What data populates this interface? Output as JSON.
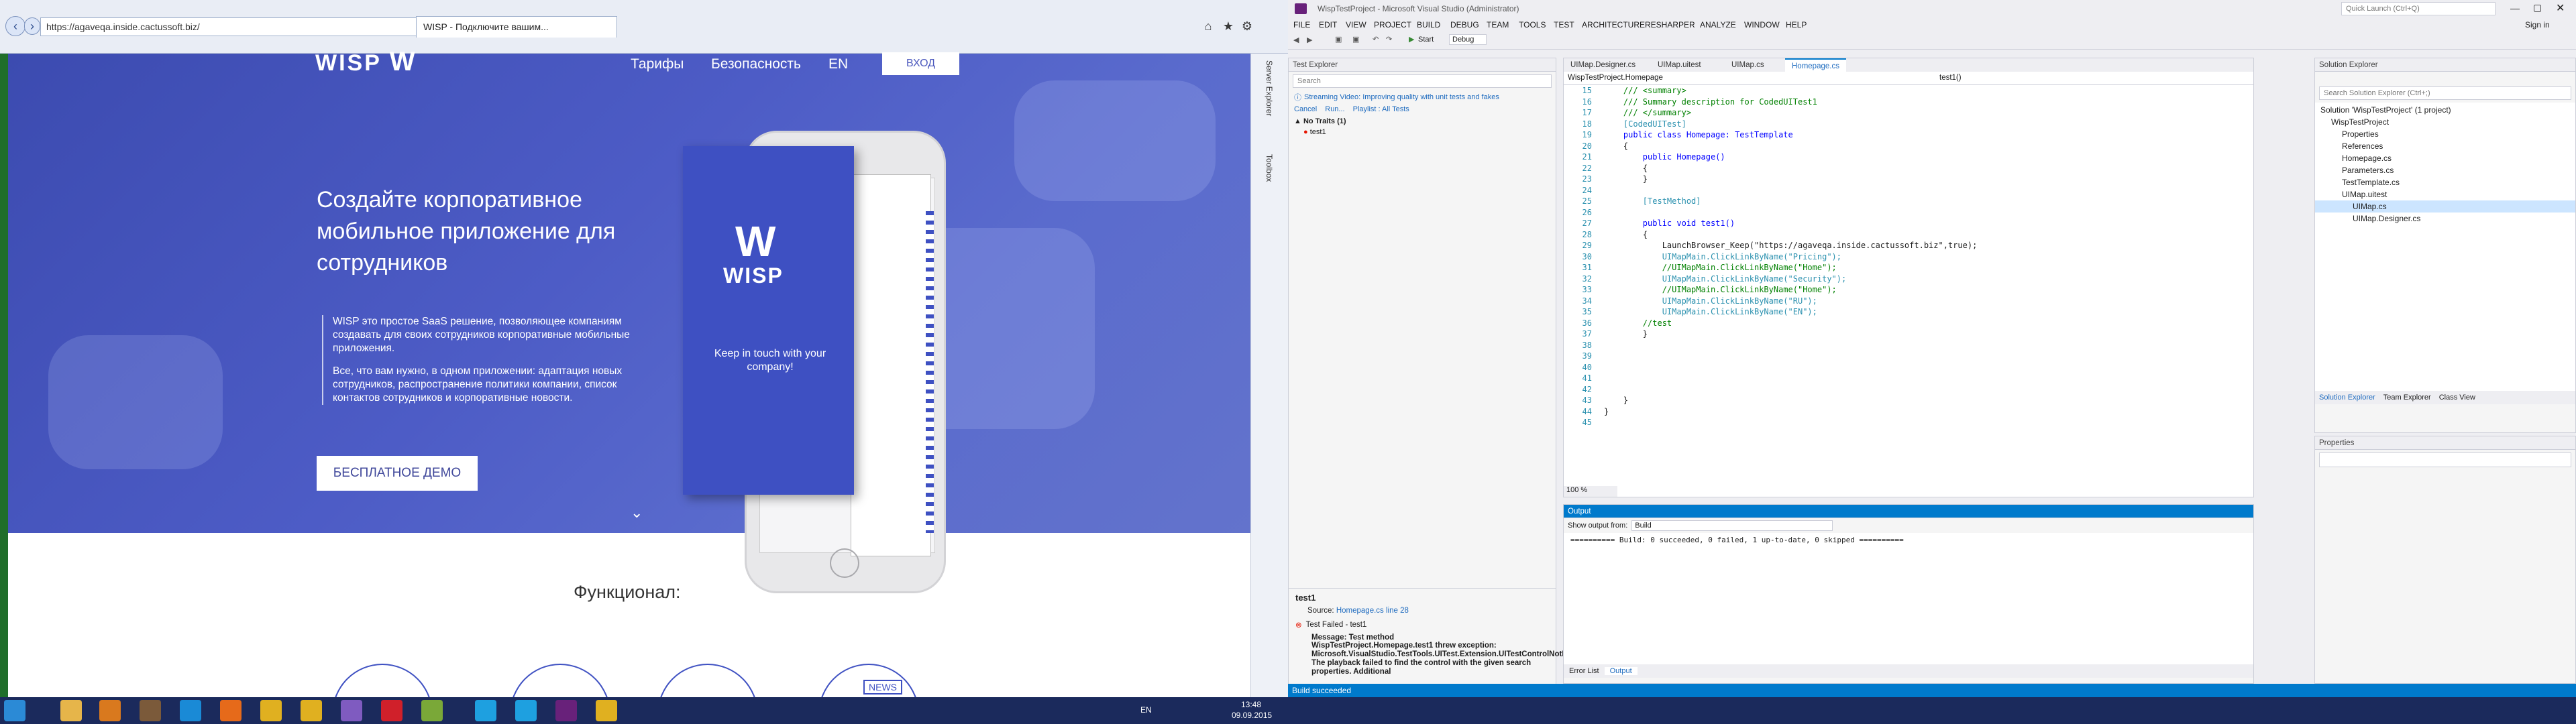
{
  "ie": {
    "address": "https://agaveqa.inside.cactussoft.biz/",
    "tab_title": "WISP - Подключите вашим...",
    "side_tabs": [
      "Server Explorer",
      "Toolbox"
    ]
  },
  "site": {
    "logo": "WISP",
    "nav": [
      "Тарифы",
      "Безопасность",
      "EN"
    ],
    "login": "ВХОД",
    "hero_title": "Создайте корпоративное мобильное приложение для сотрудников",
    "hero_p1": "WISP это простое SaaS решение, позволяющее компаниям создавать для своих сотрудников корпоративные мобильные приложения.",
    "hero_p2": "Все, что вам нужно, в одном приложении: адаптация новых сотрудников, распространение политики компании, список контактов сотрудников и корпоративные новости.",
    "demo_button": "БЕСПЛАТНОЕ ДЕМО",
    "phone_logo": "WISP",
    "phone_tagline": "Keep in touch with your company!",
    "features_title": "Функционал:",
    "feature_badge": "NEWS"
  },
  "taskbar": {
    "lang": "EN",
    "time": "13:48",
    "date": "09.09.2015"
  },
  "vs": {
    "title": "WispTestProject - Microsoft Visual Studio (Administrator)",
    "menu": [
      "FILE",
      "EDIT",
      "VIEW",
      "PROJECT",
      "BUILD",
      "DEBUG",
      "TEAM",
      "TOOLS",
      "TEST",
      "ARCHITECTURE",
      "RESHARPER",
      "ANALYZE",
      "WINDOW",
      "HELP"
    ],
    "quick_launch": "Quick Launch (Ctrl+Q)",
    "sign_in": "Sign in",
    "start_label": "Start",
    "config": "Debug",
    "status": "Build succeeded",
    "test_explorer": {
      "title": "Test Explorer",
      "search": "Search",
      "banner": "Streaming Video: Improving quality with unit tests and fakes",
      "actions": [
        "Cancel",
        "Run...",
        "Playlist : All Tests"
      ],
      "group": "No Traits (1)",
      "test": "test1",
      "detail_name": "test1",
      "source_label": "Source:",
      "source_link": "Homepage.cs line 28",
      "result": "Test Failed - test1",
      "message_label": "Message: Test method",
      "message": "WispTestProject.Homepage.test1 threw exception: Microsoft.VisualStudio.TestTools.UITest.Extension.UITestControlNotFoundException: The playback failed to find the control with the given search properties. Additional"
    },
    "editor": {
      "tabs": [
        "UIMap.Designer.cs",
        "UIMap.uitest",
        "UIMap.cs",
        "Homepage.cs"
      ],
      "active_tab": "Homepage.cs",
      "nav_left": "WispTestProject.Homepage",
      "nav_right": "test1()",
      "zoom": "100 %",
      "lines": [
        {
          "n": "15",
          "t": "    /// <summary>",
          "c": "cm"
        },
        {
          "n": "16",
          "t": "    /// Summary description for CodedUITest1",
          "c": "cm"
        },
        {
          "n": "17",
          "t": "    /// </summary>",
          "c": "cm"
        },
        {
          "n": "18",
          "t": "    [CodedUITest]",
          "c": "at"
        },
        {
          "n": "19",
          "t": "    public class Homepage: TestTemplate",
          "c": "kw"
        },
        {
          "n": "20",
          "t": "    {",
          "c": ""
        },
        {
          "n": "21",
          "t": "        public Homepage()",
          "c": "kw"
        },
        {
          "n": "22",
          "t": "        {",
          "c": ""
        },
        {
          "n": "23",
          "t": "        }",
          "c": ""
        },
        {
          "n": "24",
          "t": "",
          "c": ""
        },
        {
          "n": "25",
          "t": "        [TestMethod]",
          "c": "at"
        },
        {
          "n": "26",
          "t": "        \t  \t  \t",
          "c": ""
        },
        {
          "n": "27",
          "t": "        public void test1()",
          "c": "kw"
        },
        {
          "n": "28",
          "t": "        {",
          "c": ""
        },
        {
          "n": "29",
          "t": "            LaunchBrowser_Keep(\"https://agaveqa.inside.cactussoft.biz\",true);",
          "c": ""
        },
        {
          "n": "30",
          "t": "            UIMapMain.ClickLinkByName(\"Pricing\");",
          "c": "ty"
        },
        {
          "n": "31",
          "t": "            //UIMapMain.ClickLinkByName(\"Home\");",
          "c": "cm"
        },
        {
          "n": "32",
          "t": "            UIMapMain.ClickLinkByName(\"Security\");",
          "c": "ty"
        },
        {
          "n": "33",
          "t": "            //UIMapMain.ClickLinkByName(\"Home\");",
          "c": "cm"
        },
        {
          "n": "34",
          "t": "            UIMapMain.ClickLinkByName(\"RU\");",
          "c": "ty"
        },
        {
          "n": "35",
          "t": "            UIMapMain.ClickLinkByName(\"EN\");",
          "c": "ty"
        },
        {
          "n": "36",
          "t": "        //test",
          "c": "cm"
        },
        {
          "n": "37",
          "t": "        }",
          "c": ""
        },
        {
          "n": "38",
          "t": "",
          "c": ""
        },
        {
          "n": "39",
          "t": "",
          "c": ""
        },
        {
          "n": "40",
          "t": "",
          "c": ""
        },
        {
          "n": "41",
          "t": "",
          "c": ""
        },
        {
          "n": "42",
          "t": "",
          "c": ""
        },
        {
          "n": "43",
          "t": "    }",
          "c": ""
        },
        {
          "n": "44",
          "t": "}",
          "c": ""
        },
        {
          "n": "45",
          "t": "",
          "c": ""
        }
      ]
    },
    "output": {
      "title": "Output",
      "show_from_label": "Show output from:",
      "show_from": "Build",
      "text": "========== Build: 0 succeeded, 0 failed, 1 up-to-date, 0 skipped ==========",
      "bottom_tabs": [
        "Error List",
        "Output"
      ]
    },
    "solution": {
      "title": "Solution Explorer",
      "search": "Search Solution Explorer (Ctrl+;)",
      "items": [
        {
          "label": "Solution 'WispTestProject' (1 project)",
          "indent": 0,
          "sel": false
        },
        {
          "label": "WispTestProject",
          "indent": 1,
          "sel": false
        },
        {
          "label": "Properties",
          "indent": 2,
          "sel": false
        },
        {
          "label": "References",
          "indent": 2,
          "sel": false
        },
        {
          "label": "Homepage.cs",
          "indent": 2,
          "sel": false
        },
        {
          "label": "Parameters.cs",
          "indent": 2,
          "sel": false
        },
        {
          "label": "TestTemplate.cs",
          "indent": 2,
          "sel": false
        },
        {
          "label": "UIMap.uitest",
          "indent": 2,
          "sel": false
        },
        {
          "label": "UIMap.cs",
          "indent": 3,
          "sel": true
        },
        {
          "label": "UIMap.Designer.cs",
          "indent": 3,
          "sel": false
        }
      ],
      "bottom_tabs": [
        "Solution Explorer",
        "Team Explorer",
        "Class View"
      ]
    },
    "properties": {
      "title": "Properties"
    }
  },
  "colors": {
    "hero": "#4453be",
    "vs_blue": "#007acc",
    "taskbar": "#1b2a5c"
  }
}
